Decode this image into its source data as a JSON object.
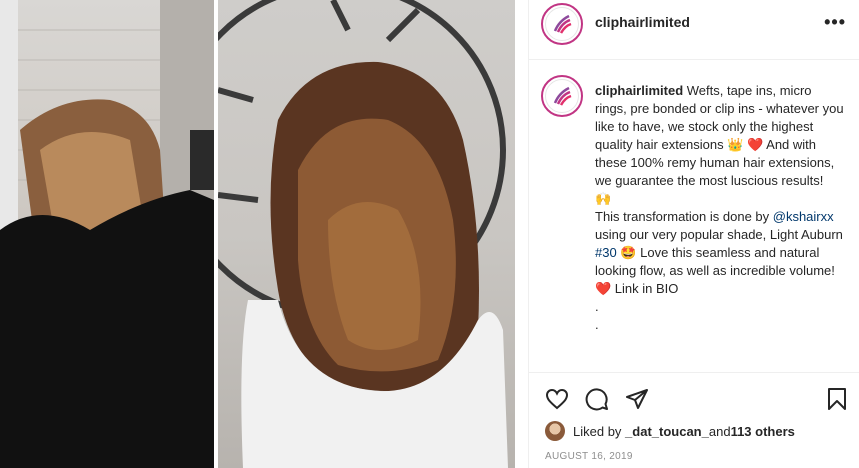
{
  "post": {
    "username": "cliphairlimited",
    "caption_user": "cliphairlimited",
    "caption_part1": " Wefts, tape ins, micro rings, pre bonded or clip ins - whatever you like to have, we stock only the highest quality hair extensions ",
    "caption_part2": " And with these 100% remy human hair extensions, we guarantee the most luscious results!",
    "caption_part3": "This transformation is done by ",
    "mention": "@kshairxx",
    "caption_part4": " using our very popular shade, Light Auburn ",
    "hashtag": "#30",
    "caption_part5": " Love this seamless and natural looking flow, as well as incredible volume! ",
    "caption_part6": " Link in BIO",
    "dot1": ".",
    "dot2": ".",
    "emoji_crown": "👑",
    "emoji_heart": "❤️",
    "emoji_hands": "🙌",
    "emoji_starstruck": "🤩",
    "emoji_heart2": "❤️"
  },
  "likes": {
    "prefix": "Liked by ",
    "user": "_dat_toucan_",
    "middle": " and ",
    "others": "113 others"
  },
  "date": "AUGUST 16, 2019",
  "colors": {
    "accent": "#c13584",
    "link": "#00376b",
    "text": "#262626",
    "muted": "#8e8e8e"
  },
  "icons": [
    "more-icon",
    "heart-icon",
    "comment-icon",
    "share-icon",
    "bookmark-icon",
    "logo-icon"
  ]
}
